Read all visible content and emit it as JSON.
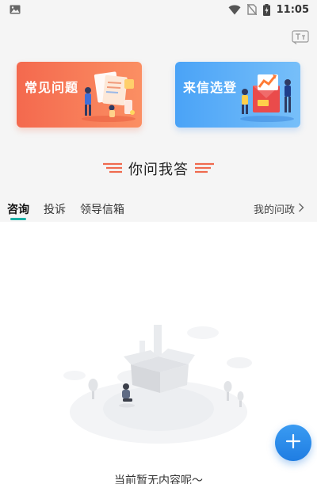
{
  "status_bar": {
    "time": "11:05"
  },
  "cards": [
    {
      "label": "常见问题",
      "accent": "#f4694e"
    },
    {
      "label": "来信选登",
      "accent": "#4aa3f7"
    }
  ],
  "section": {
    "title": "你问我答"
  },
  "tabs": [
    {
      "label": "咨询",
      "active": true
    },
    {
      "label": "投诉",
      "active": false
    },
    {
      "label": "领导信箱",
      "active": false
    }
  ],
  "my_link": {
    "label": "我的问政"
  },
  "empty_state": {
    "message": "当前暂无内容呢～"
  },
  "colors": {
    "tab_accent": "#1ab0a6",
    "fab": "#2a8cec"
  }
}
